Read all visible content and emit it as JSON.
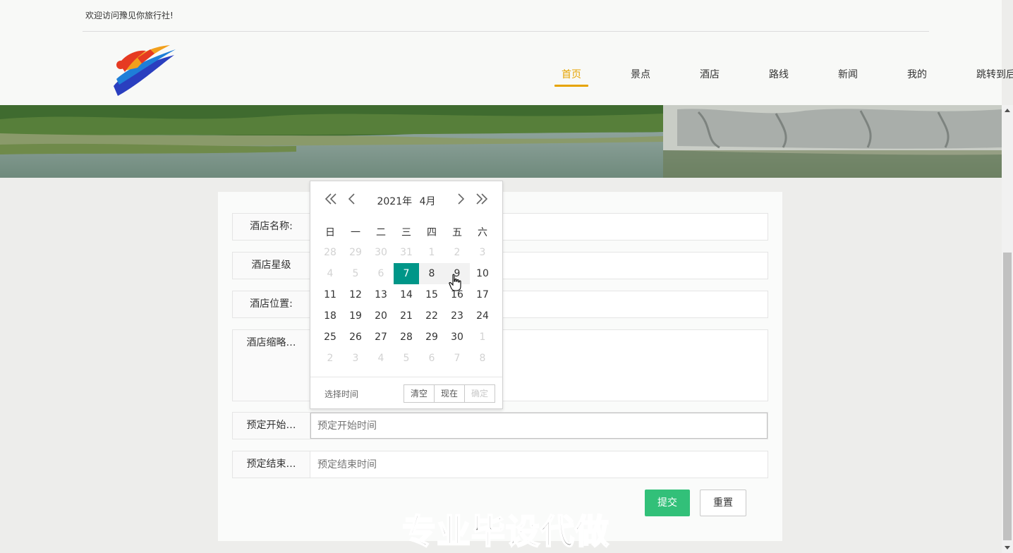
{
  "topbar": {
    "welcome": "欢迎访问豫见你旅行社!"
  },
  "nav": {
    "items": [
      "首页",
      "景点",
      "酒店",
      "路线",
      "新闻",
      "我的",
      "跳转到后台"
    ],
    "active_index": 0
  },
  "form": {
    "hotel_name_label": "酒店名称:",
    "hotel_star_label": "酒店星级",
    "hotel_location_label": "酒店位置:",
    "hotel_thumb_label": "酒店缩略…",
    "start_label": "预定开始…",
    "start_placeholder": "预定开始时间",
    "end_label": "预定结束…",
    "end_placeholder": "预定结束时间"
  },
  "buttons": {
    "submit": "提交",
    "reset": "重置"
  },
  "calendar": {
    "year": "2021年",
    "month": "4月",
    "weekdays": [
      "日",
      "一",
      "二",
      "三",
      "四",
      "五",
      "六"
    ],
    "days": [
      {
        "n": "28",
        "s": "off"
      },
      {
        "n": "29",
        "s": "off"
      },
      {
        "n": "30",
        "s": "off"
      },
      {
        "n": "31",
        "s": "off"
      },
      {
        "n": "1",
        "s": "off"
      },
      {
        "n": "2",
        "s": "off"
      },
      {
        "n": "3",
        "s": "off"
      },
      {
        "n": "4",
        "s": "off"
      },
      {
        "n": "5",
        "s": "off"
      },
      {
        "n": "6",
        "s": "off"
      },
      {
        "n": "7",
        "s": "sel"
      },
      {
        "n": "8",
        "s": "hov"
      },
      {
        "n": "9",
        "s": "hov"
      },
      {
        "n": "10",
        "s": ""
      },
      {
        "n": "11",
        "s": ""
      },
      {
        "n": "12",
        "s": ""
      },
      {
        "n": "13",
        "s": ""
      },
      {
        "n": "14",
        "s": ""
      },
      {
        "n": "15",
        "s": ""
      },
      {
        "n": "16",
        "s": ""
      },
      {
        "n": "17",
        "s": ""
      },
      {
        "n": "18",
        "s": ""
      },
      {
        "n": "19",
        "s": ""
      },
      {
        "n": "20",
        "s": ""
      },
      {
        "n": "21",
        "s": ""
      },
      {
        "n": "22",
        "s": ""
      },
      {
        "n": "23",
        "s": ""
      },
      {
        "n": "24",
        "s": ""
      },
      {
        "n": "25",
        "s": ""
      },
      {
        "n": "26",
        "s": ""
      },
      {
        "n": "27",
        "s": ""
      },
      {
        "n": "28",
        "s": ""
      },
      {
        "n": "29",
        "s": ""
      },
      {
        "n": "30",
        "s": ""
      },
      {
        "n": "1",
        "s": "off"
      },
      {
        "n": "2",
        "s": "off"
      },
      {
        "n": "3",
        "s": "off"
      },
      {
        "n": "4",
        "s": "off"
      },
      {
        "n": "5",
        "s": "off"
      },
      {
        "n": "6",
        "s": "off"
      },
      {
        "n": "7",
        "s": "off"
      },
      {
        "n": "8",
        "s": "off"
      }
    ],
    "pick_time": "选择时间",
    "clear": "清空",
    "now": "现在",
    "confirm": "确定"
  },
  "watermark": "专业毕设代做",
  "colors": {
    "nav_active": "#e6a400",
    "submit_bg": "#32c079",
    "calendar_selected": "#009688"
  }
}
